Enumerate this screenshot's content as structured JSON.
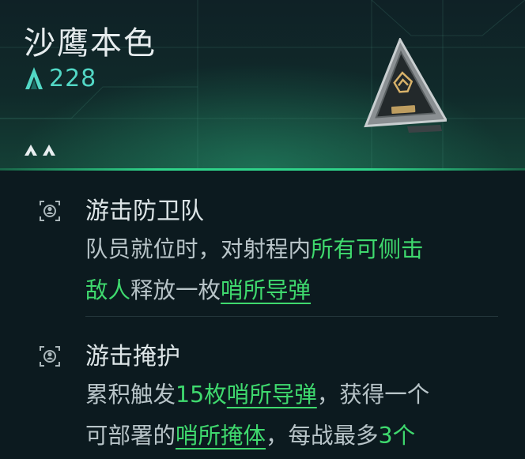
{
  "card": {
    "title": "沙鹰本色",
    "power": "228",
    "rank_chevrons": 2,
    "colors": {
      "accent_green": "#3fd96e",
      "power_cyan": "#52d7c5"
    }
  },
  "skills": [
    {
      "icon": "squad-emblem-icon",
      "name": "游击防卫队",
      "desc_line1": {
        "t1": "队员就位时，对射程内",
        "t2": "所有可侧击"
      },
      "desc_line2": {
        "t1": "敌人",
        "t2": "释放一枚",
        "t3": "哨所导弹"
      }
    },
    {
      "icon": "squad-emblem-icon",
      "name": "游击掩护",
      "desc_line1": {
        "t1": "累积触发",
        "t2": "15枚",
        "t3": "哨所导弹",
        "t4": "，获得一个"
      },
      "desc_line2": {
        "t1": "可部署的",
        "t2": "哨所掩体",
        "t3": "，每战最多",
        "t4": "3个"
      }
    }
  ]
}
